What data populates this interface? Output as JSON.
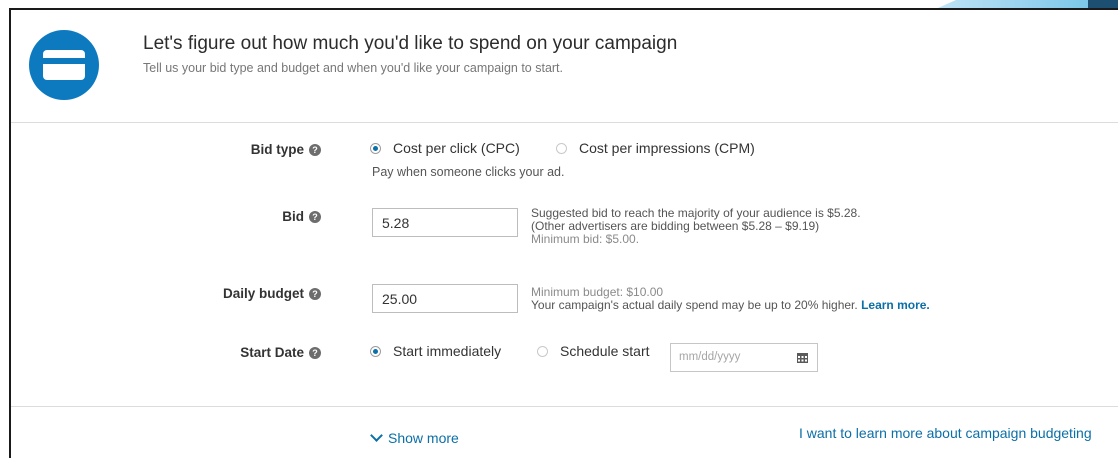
{
  "header": {
    "title": "Let's figure out how much you'd like to spend on your campaign",
    "subtitle": "Tell us your bid type and budget and when you'd like your campaign to start.",
    "icon": "credit-card-icon"
  },
  "bid_type": {
    "label": "Bid type",
    "options": [
      "Cost per click (CPC)",
      "Cost per impressions (CPM)"
    ],
    "selected": "Cost per click (CPC)",
    "note": "Pay when someone clicks your ad."
  },
  "bid": {
    "label": "Bid",
    "value": "5.28",
    "hint_line1": "Suggested bid to reach the majority of your audience is $5.28.",
    "hint_line2": "(Other advertisers are bidding between $5.28 – $9.19)",
    "hint_line3": "Minimum bid: $5.00."
  },
  "daily_budget": {
    "label": "Daily budget",
    "value": "25.00",
    "hint_line1": "Minimum budget: $10.00",
    "hint_line2": "Your campaign's actual daily spend may be up to 20% higher.",
    "learn_more": "Learn more."
  },
  "start_date": {
    "label": "Start Date",
    "options": [
      "Start immediately",
      "Schedule start"
    ],
    "selected": "Start immediately",
    "date_placeholder": "mm/dd/yyyy"
  },
  "footer": {
    "show_more": "Show more",
    "learn_link": "I want to learn more about campaign budgeting"
  },
  "help_glyph": "?",
  "colors": {
    "accent": "#0b6fa8",
    "icon_bg": "#0d7ac0"
  }
}
